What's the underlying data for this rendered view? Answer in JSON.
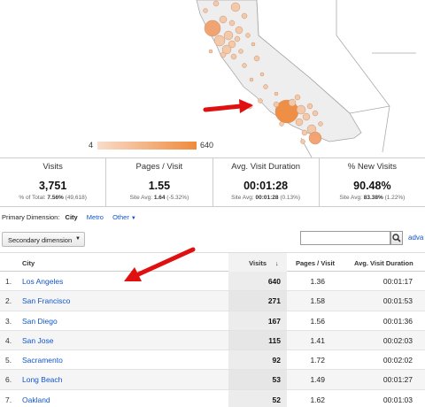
{
  "legend": {
    "min": "4",
    "max": "640"
  },
  "colors": {
    "accent": "#f08a3c",
    "link": "#1155cc",
    "arrow": "#e01010"
  },
  "metrics": [
    {
      "label": "Visits",
      "value": "3,751",
      "sub_prefix": "% of Total: ",
      "sub_bold": "7.56%",
      "sub_suffix": " (49,618)"
    },
    {
      "label": "Pages / Visit",
      "value": "1.55",
      "sub_prefix": "Site Avg: ",
      "sub_bold": "1.64",
      "sub_suffix": " (-5.32%)"
    },
    {
      "label": "Avg. Visit Duration",
      "value": "00:01:28",
      "sub_prefix": "Site Avg: ",
      "sub_bold": "00:01:28",
      "sub_suffix": " (0.13%)"
    },
    {
      "label": "% New Visits",
      "value": "90.48%",
      "sub_prefix": "Site Avg: ",
      "sub_bold": "83.38%",
      "sub_suffix": " (1.22%)"
    }
  ],
  "primary_dimension": {
    "label": "Primary Dimension:",
    "selected": "City",
    "metro": "Metro",
    "other": "Other"
  },
  "secondary_dimension": "Secondary dimension",
  "search": {
    "placeholder": "",
    "icon": "search-icon"
  },
  "advanced_link": "adva",
  "table": {
    "headers": {
      "city": "City",
      "visits": "Visits",
      "sort_icon": "↓",
      "pages": "Pages / Visit",
      "duration": "Avg. Visit Duration"
    },
    "rows": [
      {
        "idx": "1.",
        "city": "Los Angeles",
        "visits": "640",
        "pages": "1.36",
        "duration": "00:01:17"
      },
      {
        "idx": "2.",
        "city": "San Francisco",
        "visits": "271",
        "pages": "1.58",
        "duration": "00:01:53"
      },
      {
        "idx": "3.",
        "city": "San Diego",
        "visits": "167",
        "pages": "1.56",
        "duration": "00:01:36"
      },
      {
        "idx": "4.",
        "city": "San Jose",
        "visits": "115",
        "pages": "1.41",
        "duration": "00:02:03"
      },
      {
        "idx": "5.",
        "city": "Sacramento",
        "visits": "92",
        "pages": "1.72",
        "duration": "00:02:02"
      },
      {
        "idx": "6.",
        "city": "Long Beach",
        "visits": "53",
        "pages": "1.49",
        "duration": "00:01:27"
      },
      {
        "idx": "7.",
        "city": "Oakland",
        "visits": "52",
        "pages": "1.62",
        "duration": "00:01:03"
      }
    ]
  }
}
